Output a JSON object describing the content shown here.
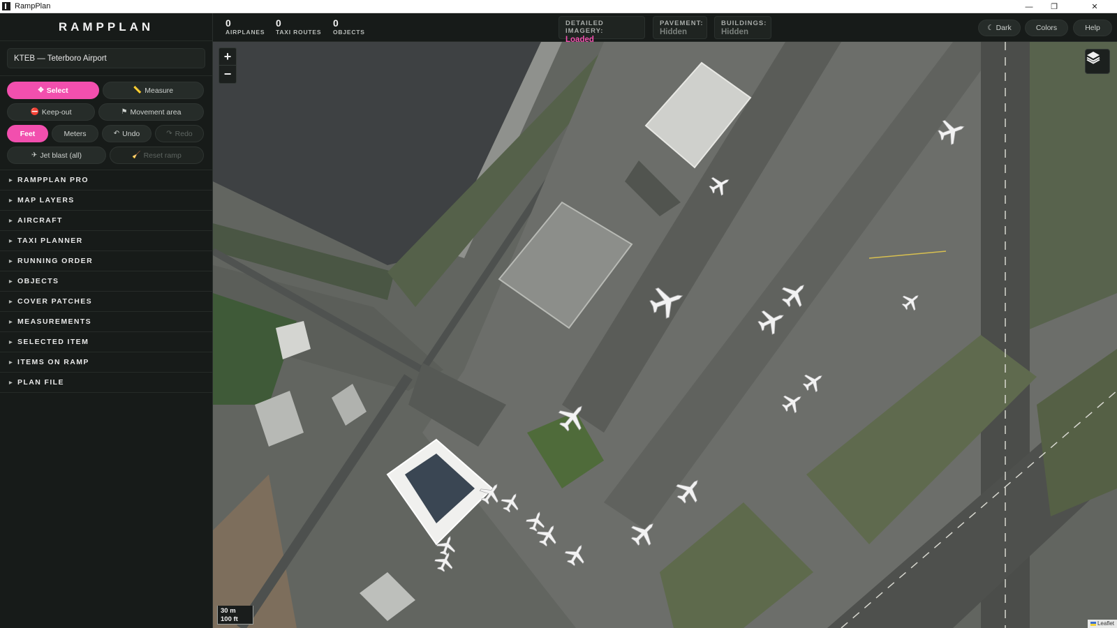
{
  "window": {
    "title": "RampPlan",
    "minimize_glyph": "—",
    "restore_glyph": "❐",
    "close_glyph": "✕"
  },
  "sidebar": {
    "brand": "RAMPPLAN",
    "airport": "KTEB — Teterboro Airport",
    "tools": {
      "select": "Select",
      "measure": "Measure",
      "keepout": "Keep-out",
      "movement": "Movement area",
      "feet": "Feet",
      "meters": "Meters",
      "undo": "Undo",
      "redo": "Redo",
      "jetblast": "Jet blast (all)",
      "reset": "Reset ramp"
    },
    "sections": [
      {
        "label": "RAMPPLAN PRO"
      },
      {
        "label": "MAP LAYERS"
      },
      {
        "label": "AIRCRAFT"
      },
      {
        "label": "TAXI PLANNER"
      },
      {
        "label": "RUNNING ORDER"
      },
      {
        "label": "OBJECTS"
      },
      {
        "label": "COVER PATCHES"
      },
      {
        "label": "MEASUREMENTS"
      },
      {
        "label": "SELECTED ITEM"
      },
      {
        "label": "ITEMS ON RAMP"
      },
      {
        "label": "PLAN FILE"
      }
    ]
  },
  "topbar": {
    "stats": [
      {
        "value": "0",
        "label": "AIRPLANES"
      },
      {
        "value": "0",
        "label": "TAXI ROUTES"
      },
      {
        "value": "0",
        "label": "OBJECTS"
      }
    ],
    "status": [
      {
        "key": "DETAILED IMAGERY:",
        "value": "Loaded"
      },
      {
        "key": "PAVEMENT:",
        "value": "Hidden"
      },
      {
        "key": "BUILDINGS:",
        "value": "Hidden"
      }
    ],
    "buttons": {
      "dark": "☾ Dark",
      "colors": "Colors",
      "help": "Help"
    }
  },
  "map": {
    "zoom_in": "+",
    "zoom_out": "−",
    "scale_m": "30 m",
    "scale_ft": "100 ft",
    "attribution": "Leaflet"
  },
  "colors": {
    "accent": "#f24fae",
    "panel": "#171b19"
  }
}
